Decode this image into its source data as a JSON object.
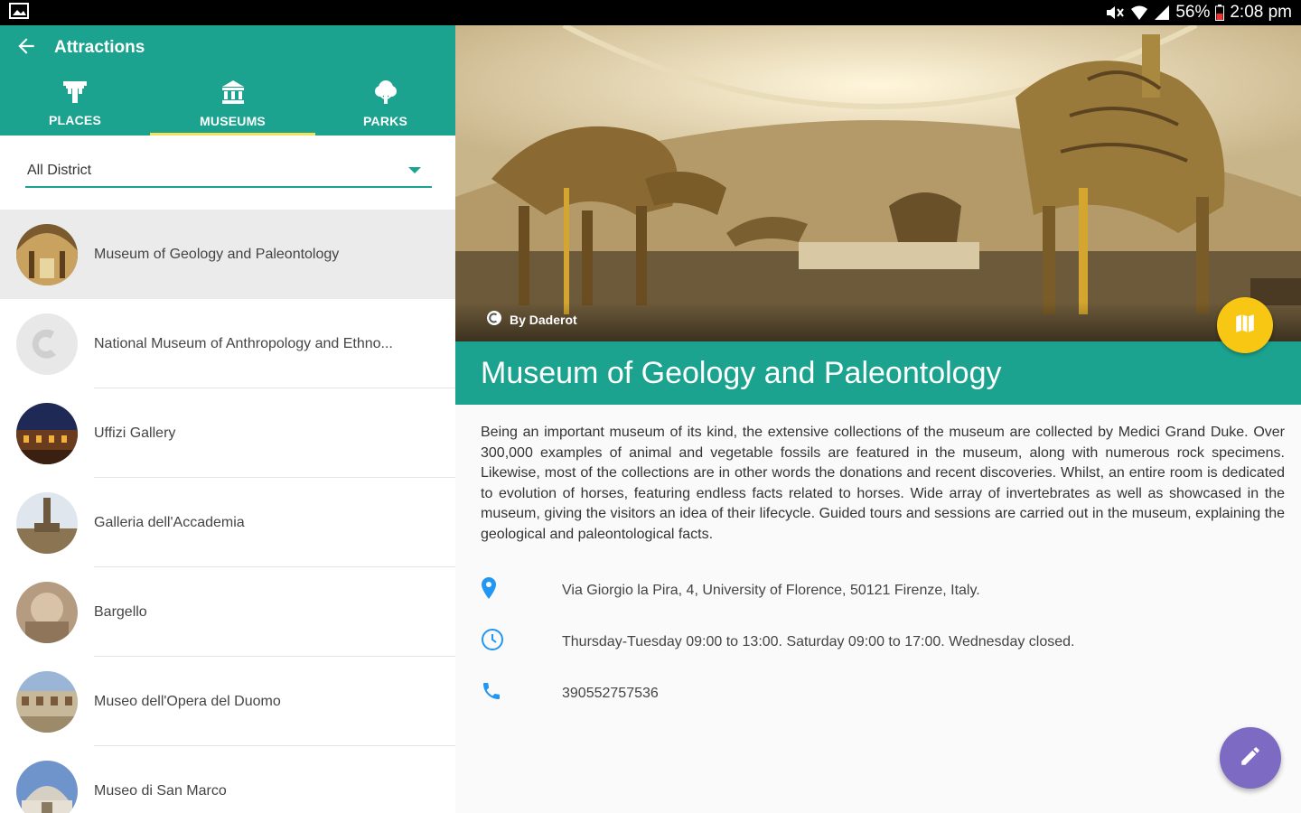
{
  "status_bar": {
    "battery": "56%",
    "time": "2:08 pm"
  },
  "app_bar": {
    "title": "Attractions"
  },
  "tabs": [
    {
      "label": "PLACES",
      "icon": "places-icon",
      "active": false
    },
    {
      "label": "MUSEUMS",
      "icon": "museums-icon",
      "active": true
    },
    {
      "label": "PARKS",
      "icon": "parks-icon",
      "active": false
    }
  ],
  "filter": {
    "selected": "All District"
  },
  "attractions": [
    {
      "name": "Museum of Geology and Paleontology",
      "selected": true
    },
    {
      "name": "National Museum of Anthropology and Ethno..."
    },
    {
      "name": "Uffizi Gallery"
    },
    {
      "name": "Galleria dell'Accademia"
    },
    {
      "name": "Bargello"
    },
    {
      "name": "Museo dell'Opera del Duomo"
    },
    {
      "name": "Museo di San Marco"
    }
  ],
  "detail": {
    "photo_credit": "By Daderot",
    "title": "Museum of Geology and Paleontology",
    "description": "Being an important museum of its kind, the extensive collections of the museum are collected by Medici Grand Duke. Over 300,000 examples of animal and vegetable fossils are featured in the museum, along with numerous rock specimens. Likewise, most of the collections are in other words the donations and recent discoveries. Whilst, an entire room is dedicated to evolution of horses, featuring endless facts related to horses. Wide array of invertebrates as well as showcased in the museum, giving the visitors an idea of their lifecycle. Guided tours and sessions are carried out in the museum, explaining the geological and paleontological facts.",
    "address": "Via Giorgio la Pira, 4, University of Florence, 50121 Firenze, Italy.",
    "hours": "Thursday-Tuesday 09:00 to 13:00. Saturday 09:00 to 17:00. Wednesday closed.",
    "phone": "390552757536"
  },
  "colors": {
    "primary": "#1ba38f",
    "tab_indicator": "#f5e15a",
    "map_fab": "#f7c714",
    "edit_fab": "#7d6bc3",
    "info_icon": "#2196f3"
  }
}
